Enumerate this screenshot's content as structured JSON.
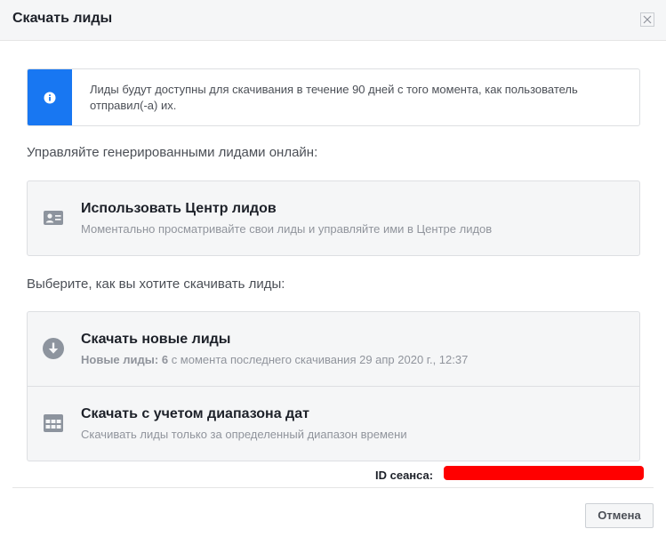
{
  "dialog": {
    "title": "Скачать лиды",
    "close_icon": "close-icon"
  },
  "info": {
    "icon": "info-icon",
    "text": "Лиды будут доступны для скачивания в течение 90 дней с того момента, как пользователь отправил(-а) их.",
    "strip_color": "#1877f2"
  },
  "manage_section": {
    "label": "Управляйте генерированными лидами онлайн:",
    "leads_center": {
      "icon": "contact-card-icon",
      "title": "Использовать Центр лидов",
      "subtitle": "Моментально просматривайте свои лиды и управляйте ими в Центре лидов"
    }
  },
  "download_section": {
    "label": "Выберите, как вы хотите скачивать лиды:",
    "new_leads": {
      "icon": "download-arrow-icon",
      "title": "Скачать новые лиды",
      "count_label": "Новые лиды:",
      "count": "6",
      "subtitle_rest": "с момента последнего скачивания 29 апр 2020 г., 12:37"
    },
    "date_range": {
      "icon": "calendar-grid-icon",
      "title": "Скачать с учетом диапазона дат",
      "subtitle": "Скачивать лиды только за определенный диапазон времени"
    }
  },
  "footer": {
    "session_label": "ID сеанса:",
    "cancel_label": "Отмена"
  }
}
